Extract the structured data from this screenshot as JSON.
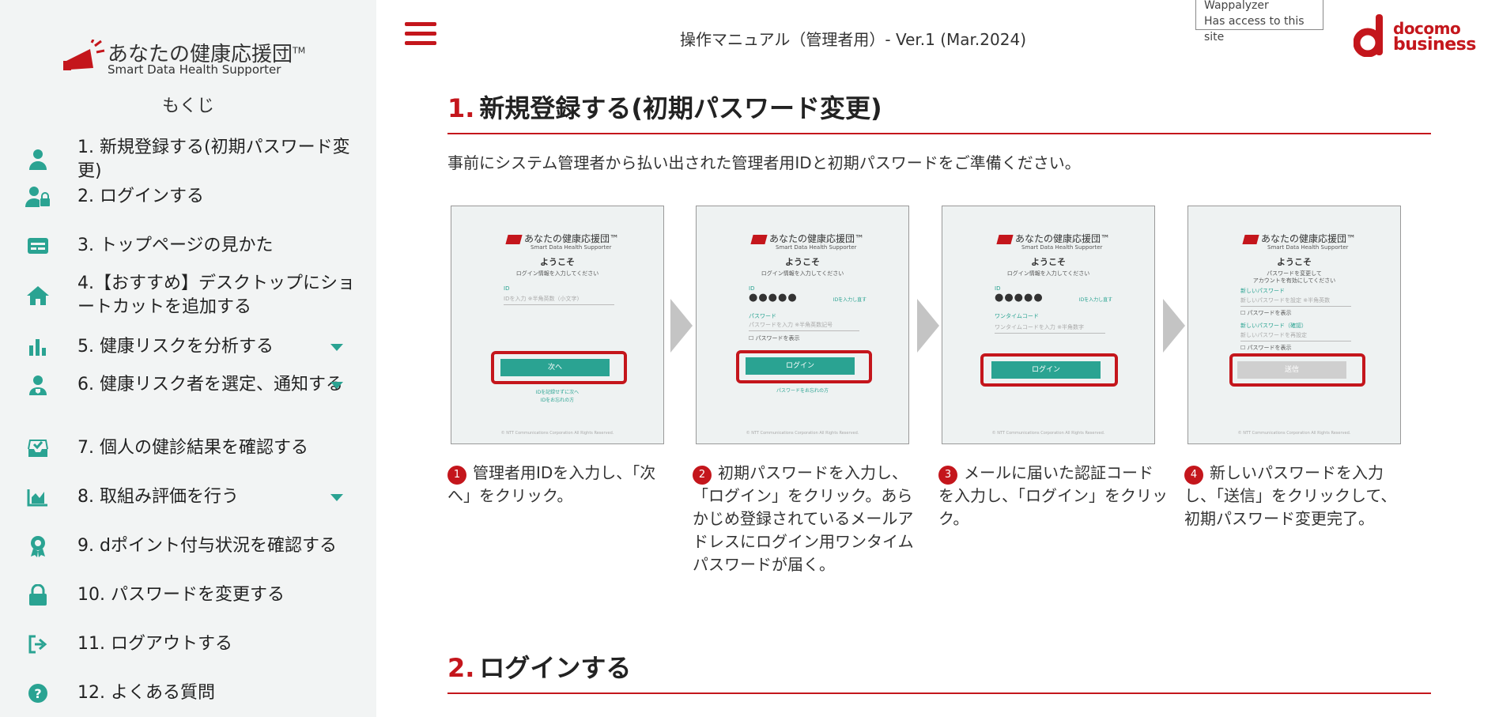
{
  "sidebar": {
    "logo_title": "あなたの健康応援団",
    "logo_tm": "TM",
    "logo_sub": "Smart Data Health Supporter",
    "toc_title": "もくじ",
    "items": [
      {
        "label": "1. 新規登録する(初期パスワード変更)",
        "icon": "person-icon",
        "expandable": false
      },
      {
        "label": "2. ログインする",
        "icon": "user-lock-icon",
        "expandable": false
      },
      {
        "label": "3. トップページの見かた",
        "icon": "id-card-icon",
        "expandable": false
      },
      {
        "label": "4.【おすすめ】デスクトップにショートカットを追加する",
        "icon": "home-icon",
        "expandable": false
      },
      {
        "label": "5. 健康リスクを分析する",
        "icon": "bar-chart-icon",
        "expandable": true
      },
      {
        "label": "6. 健康リスク者を選定、通知する",
        "icon": "user-shield-icon",
        "expandable": true
      },
      {
        "label": "7. 個人の健診結果を確認する",
        "icon": "check-inbox-icon",
        "expandable": false
      },
      {
        "label": "8. 取組み評価を行う",
        "icon": "area-chart-icon",
        "expandable": true
      },
      {
        "label": "9. dポイント付与状況を確認する",
        "icon": "award-icon",
        "expandable": false
      },
      {
        "label": "10. パスワードを変更する",
        "icon": "lock-icon",
        "expandable": false
      },
      {
        "label": "11. ログアウトする",
        "icon": "logout-icon",
        "expandable": false
      },
      {
        "label": "12. よくある質問",
        "icon": "question-icon",
        "expandable": false
      }
    ]
  },
  "header": {
    "doc_title": "操作マニュアル（管理者用）- Ver.1 (Mar.2024)",
    "wappalyzer_line1": "Wappalyzer",
    "wappalyzer_line2": "Has access to this site",
    "brand_line1": "docomo",
    "brand_line2": "business"
  },
  "section1": {
    "num": "1.",
    "title": "新規登録する(初期パスワード変更)",
    "intro": "事前にシステム管理者から払い出された管理者用IDと初期パスワードをご準備ください。",
    "steps": [
      {
        "num": "1",
        "caption": "管理者用IDを入力し、「次へ」をクリック。",
        "screen": {
          "logo": "あなたの健康応援団™",
          "sub": "Smart Data Health Supporter",
          "welcome": "ようこそ",
          "text": "ログイン情報を入力してください",
          "id_label": "ID",
          "id_placeholder": "IDを入力 ※半角英数（小文字)",
          "button": "次へ",
          "link1": "IDを記録せずに次へ",
          "link2": "IDをお忘れの方",
          "footer": "© NTT Communications Corporation All Rights Reserved."
        }
      },
      {
        "num": "2",
        "caption": "初期パスワードを入力し、「ログイン」をクリック。あらかじめ登録されているメールアドレスにログイン用ワンタイムパスワードが届く。",
        "screen": {
          "logo": "あなたの健康応援団™",
          "sub": "Smart Data Health Supporter",
          "welcome": "ようこそ",
          "text": "ログイン情報を入力してください",
          "id_label": "ID",
          "masked": "●●●●●",
          "reenter": "IDを入力し直す",
          "pw_label": "パスワード",
          "pw_placeholder": "パスワードを入力 ※半角英数記号",
          "show_pw": "パスワードを表示",
          "button": "ログイン",
          "link": "パスワードをお忘れの方",
          "footer": "© NTT Communications Corporation All Rights Reserved."
        }
      },
      {
        "num": "3",
        "caption": "メールに届いた認証コードを入力し、「ログイン」をクリック。",
        "screen": {
          "logo": "あなたの健康応援団™",
          "sub": "Smart Data Health Supporter",
          "welcome": "ようこそ",
          "text": "ログイン情報を入力してください",
          "id_label": "ID",
          "masked": "●●●●●",
          "reenter": "IDを入力し直す",
          "otp_label": "ワンタイムコード",
          "otp_placeholder": "ワンタイムコードを入力 ※半角数字",
          "button": "ログイン",
          "footer": "© NTT Communications Corporation All Rights Reserved."
        }
      },
      {
        "num": "4",
        "caption": "新しいパスワードを入力し、「送信」をクリックして、初期パスワード変更完了。",
        "screen": {
          "logo": "あなたの健康応援団™",
          "sub": "Smart Data Health Supporter",
          "welcome": "ようこそ",
          "text1": "パスワードを変更して",
          "text2": "アカウントを有効にしてください",
          "new_label": "新しいパスワード",
          "new_placeholder": "新しいパスワードを設定 ※半角英数",
          "show_pw": "パスワードを表示",
          "confirm_label": "新しいパスワード（確認）",
          "confirm_placeholder": "新しいパスワードを再設定",
          "show_pw2": "パスワードを表示",
          "button": "送信",
          "footer": "© NTT Communications Corporation All Rights Reserved."
        }
      }
    ]
  },
  "section2": {
    "num": "2.",
    "title": "ログインする"
  }
}
